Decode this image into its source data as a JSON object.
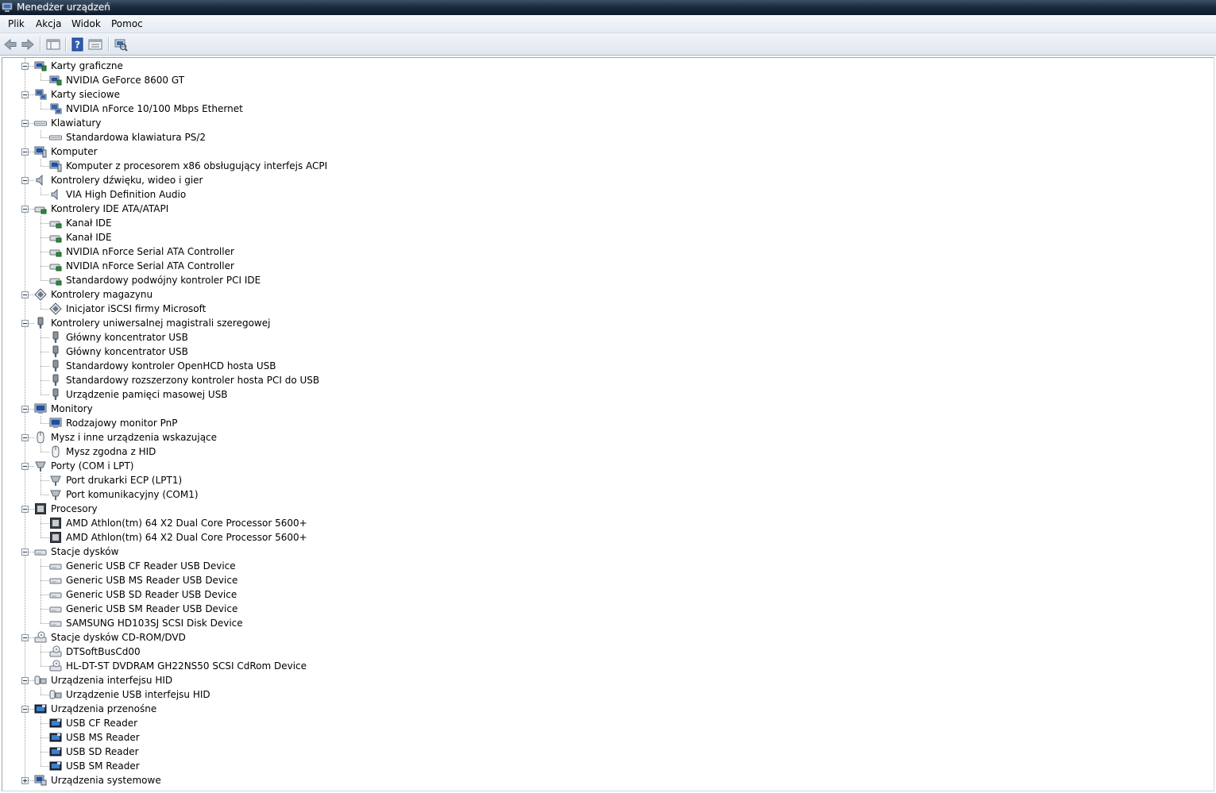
{
  "window": {
    "title": "Menedżer urządzeń"
  },
  "menu": [
    "Plik",
    "Akcja",
    "Widok",
    "Pomoc"
  ],
  "toolbar": [
    {
      "name": "back-arrow-icon"
    },
    {
      "name": "forward-arrow-icon"
    },
    {
      "name": "console-tree-icon"
    },
    {
      "name": "help-icon"
    },
    {
      "name": "properties-icon"
    },
    {
      "name": "scan-hardware-icon"
    }
  ],
  "tree": [
    {
      "label": "Karty graficzne",
      "icon": "display-adapter",
      "expanded": true,
      "children": [
        {
          "label": "NVIDIA GeForce 8600 GT",
          "icon": "display-adapter"
        }
      ]
    },
    {
      "label": "Karty sieciowe",
      "icon": "network",
      "expanded": true,
      "children": [
        {
          "label": "NVIDIA nForce 10/100 Mbps Ethernet",
          "icon": "network"
        }
      ]
    },
    {
      "label": "Klawiatury",
      "icon": "keyboard",
      "expanded": true,
      "children": [
        {
          "label": "Standardowa klawiatura PS/2",
          "icon": "keyboard"
        }
      ]
    },
    {
      "label": "Komputer",
      "icon": "computer",
      "expanded": true,
      "children": [
        {
          "label": "Komputer z procesorem x86 obsługujący interfejs ACPI",
          "icon": "computer"
        }
      ]
    },
    {
      "label": "Kontrolery dźwięku, wideo i gier",
      "icon": "speaker",
      "expanded": true,
      "children": [
        {
          "label": "VIA High Definition Audio",
          "icon": "speaker"
        }
      ]
    },
    {
      "label": "Kontrolery IDE ATA/ATAPI",
      "icon": "ide",
      "expanded": true,
      "children": [
        {
          "label": "Kanał IDE",
          "icon": "ide"
        },
        {
          "label": "Kanał IDE",
          "icon": "ide"
        },
        {
          "label": "NVIDIA nForce Serial ATA Controller",
          "icon": "ide"
        },
        {
          "label": "NVIDIA nForce Serial ATA Controller",
          "icon": "ide"
        },
        {
          "label": "Standardowy podwójny kontroler PCI IDE",
          "icon": "ide"
        }
      ]
    },
    {
      "label": "Kontrolery magazynu",
      "icon": "storage",
      "expanded": true,
      "children": [
        {
          "label": "Inicjator iSCSI firmy Microsoft",
          "icon": "storage"
        }
      ]
    },
    {
      "label": "Kontrolery uniwersalnej magistrali szeregowej",
      "icon": "usb",
      "expanded": true,
      "children": [
        {
          "label": "Główny koncentrator USB",
          "icon": "usb"
        },
        {
          "label": "Główny koncentrator USB",
          "icon": "usb"
        },
        {
          "label": "Standardowy kontroler OpenHCD hosta USB",
          "icon": "usb"
        },
        {
          "label": "Standardowy rozszerzony kontroler hosta PCI do USB",
          "icon": "usb"
        },
        {
          "label": "Urządzenie pamięci masowej USB",
          "icon": "usb"
        }
      ]
    },
    {
      "label": "Monitory",
      "icon": "monitor",
      "expanded": true,
      "children": [
        {
          "label": "Rodzajowy monitor PnP",
          "icon": "monitor"
        }
      ]
    },
    {
      "label": "Mysz i inne urządzenia wskazujące",
      "icon": "mouse",
      "expanded": true,
      "children": [
        {
          "label": "Mysz zgodna z HID",
          "icon": "mouse"
        }
      ]
    },
    {
      "label": "Porty (COM i LPT)",
      "icon": "port",
      "expanded": true,
      "children": [
        {
          "label": "Port drukarki ECP (LPT1)",
          "icon": "port"
        },
        {
          "label": "Port komunikacyjny (COM1)",
          "icon": "port"
        }
      ]
    },
    {
      "label": "Procesory",
      "icon": "cpu",
      "expanded": true,
      "children": [
        {
          "label": "AMD Athlon(tm) 64 X2 Dual Core Processor 5600+",
          "icon": "cpu"
        },
        {
          "label": "AMD Athlon(tm) 64 X2 Dual Core Processor 5600+",
          "icon": "cpu"
        }
      ]
    },
    {
      "label": "Stacje dysków",
      "icon": "disk",
      "expanded": true,
      "children": [
        {
          "label": "Generic USB CF Reader USB Device",
          "icon": "disk"
        },
        {
          "label": "Generic USB MS Reader USB Device",
          "icon": "disk"
        },
        {
          "label": "Generic USB SD Reader USB Device",
          "icon": "disk"
        },
        {
          "label": "Generic USB SM Reader USB Device",
          "icon": "disk"
        },
        {
          "label": "SAMSUNG HD103SJ SCSI Disk Device",
          "icon": "disk"
        }
      ]
    },
    {
      "label": "Stacje dysków CD-ROM/DVD",
      "icon": "cdrom",
      "expanded": true,
      "children": [
        {
          "label": "DTSoftBusCd00",
          "icon": "cdrom"
        },
        {
          "label": "HL-DT-ST DVDRAM GH22NS50 SCSI CdRom Device",
          "icon": "cdrom"
        }
      ]
    },
    {
      "label": "Urządzenia interfejsu HID",
      "icon": "hid",
      "expanded": true,
      "children": [
        {
          "label": "Urządzenie USB interfejsu HID",
          "icon": "hid"
        }
      ]
    },
    {
      "label": "Urządzenia przenośne",
      "icon": "portable",
      "expanded": true,
      "children": [
        {
          "label": "USB CF Reader",
          "icon": "portable"
        },
        {
          "label": "USB MS Reader",
          "icon": "portable"
        },
        {
          "label": "USB SD Reader",
          "icon": "portable"
        },
        {
          "label": "USB SM Reader",
          "icon": "portable"
        }
      ]
    },
    {
      "label": "Urządzenia systemowe",
      "icon": "system",
      "expanded": false,
      "children": []
    }
  ]
}
